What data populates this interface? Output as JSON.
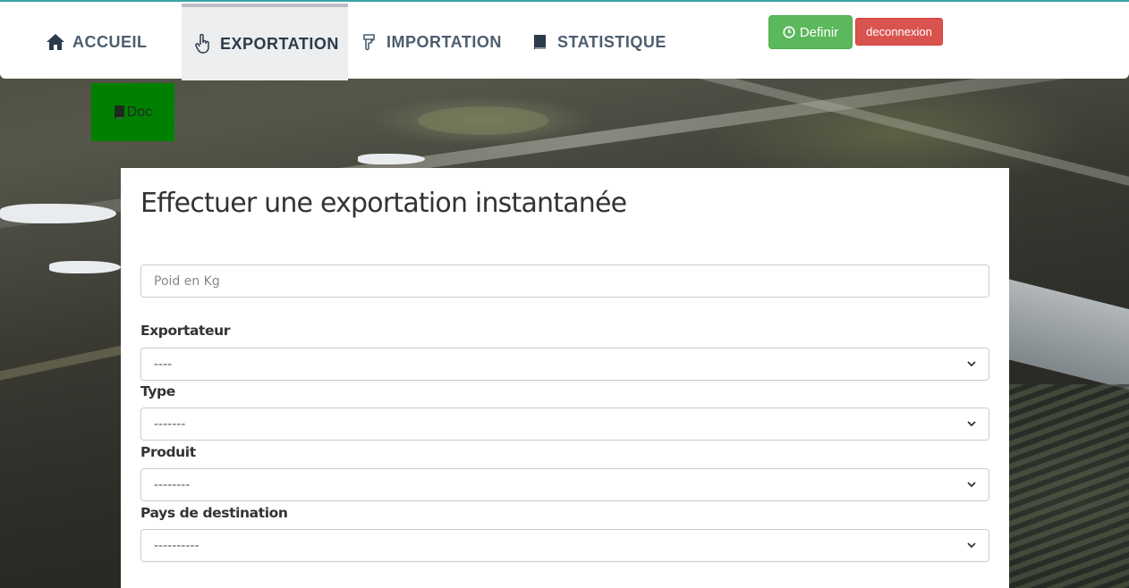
{
  "nav": {
    "home_label": "ACCUEIL",
    "export_label": "EXPORTATION",
    "import_label": "IMPORTATION",
    "stat_label": "STATISTIQUE",
    "definir_label": "Definir",
    "deconnexion_label": "deconnexion",
    "accent_active_bg": "#eceeef"
  },
  "doc_button": {
    "label": "Doc",
    "color": "#008000"
  },
  "form": {
    "title": "Effectuer une exportation instantanée",
    "weight_placeholder": "Poid en Kg",
    "fields": [
      {
        "label": "Exportateur",
        "selected": "----"
      },
      {
        "label": "Type",
        "selected": "-------"
      },
      {
        "label": "Produit",
        "selected": "--------"
      },
      {
        "label": "Pays de destination",
        "selected": "----------"
      }
    ]
  },
  "colors": {
    "success": "#5cb85c",
    "danger": "#d9534f"
  }
}
